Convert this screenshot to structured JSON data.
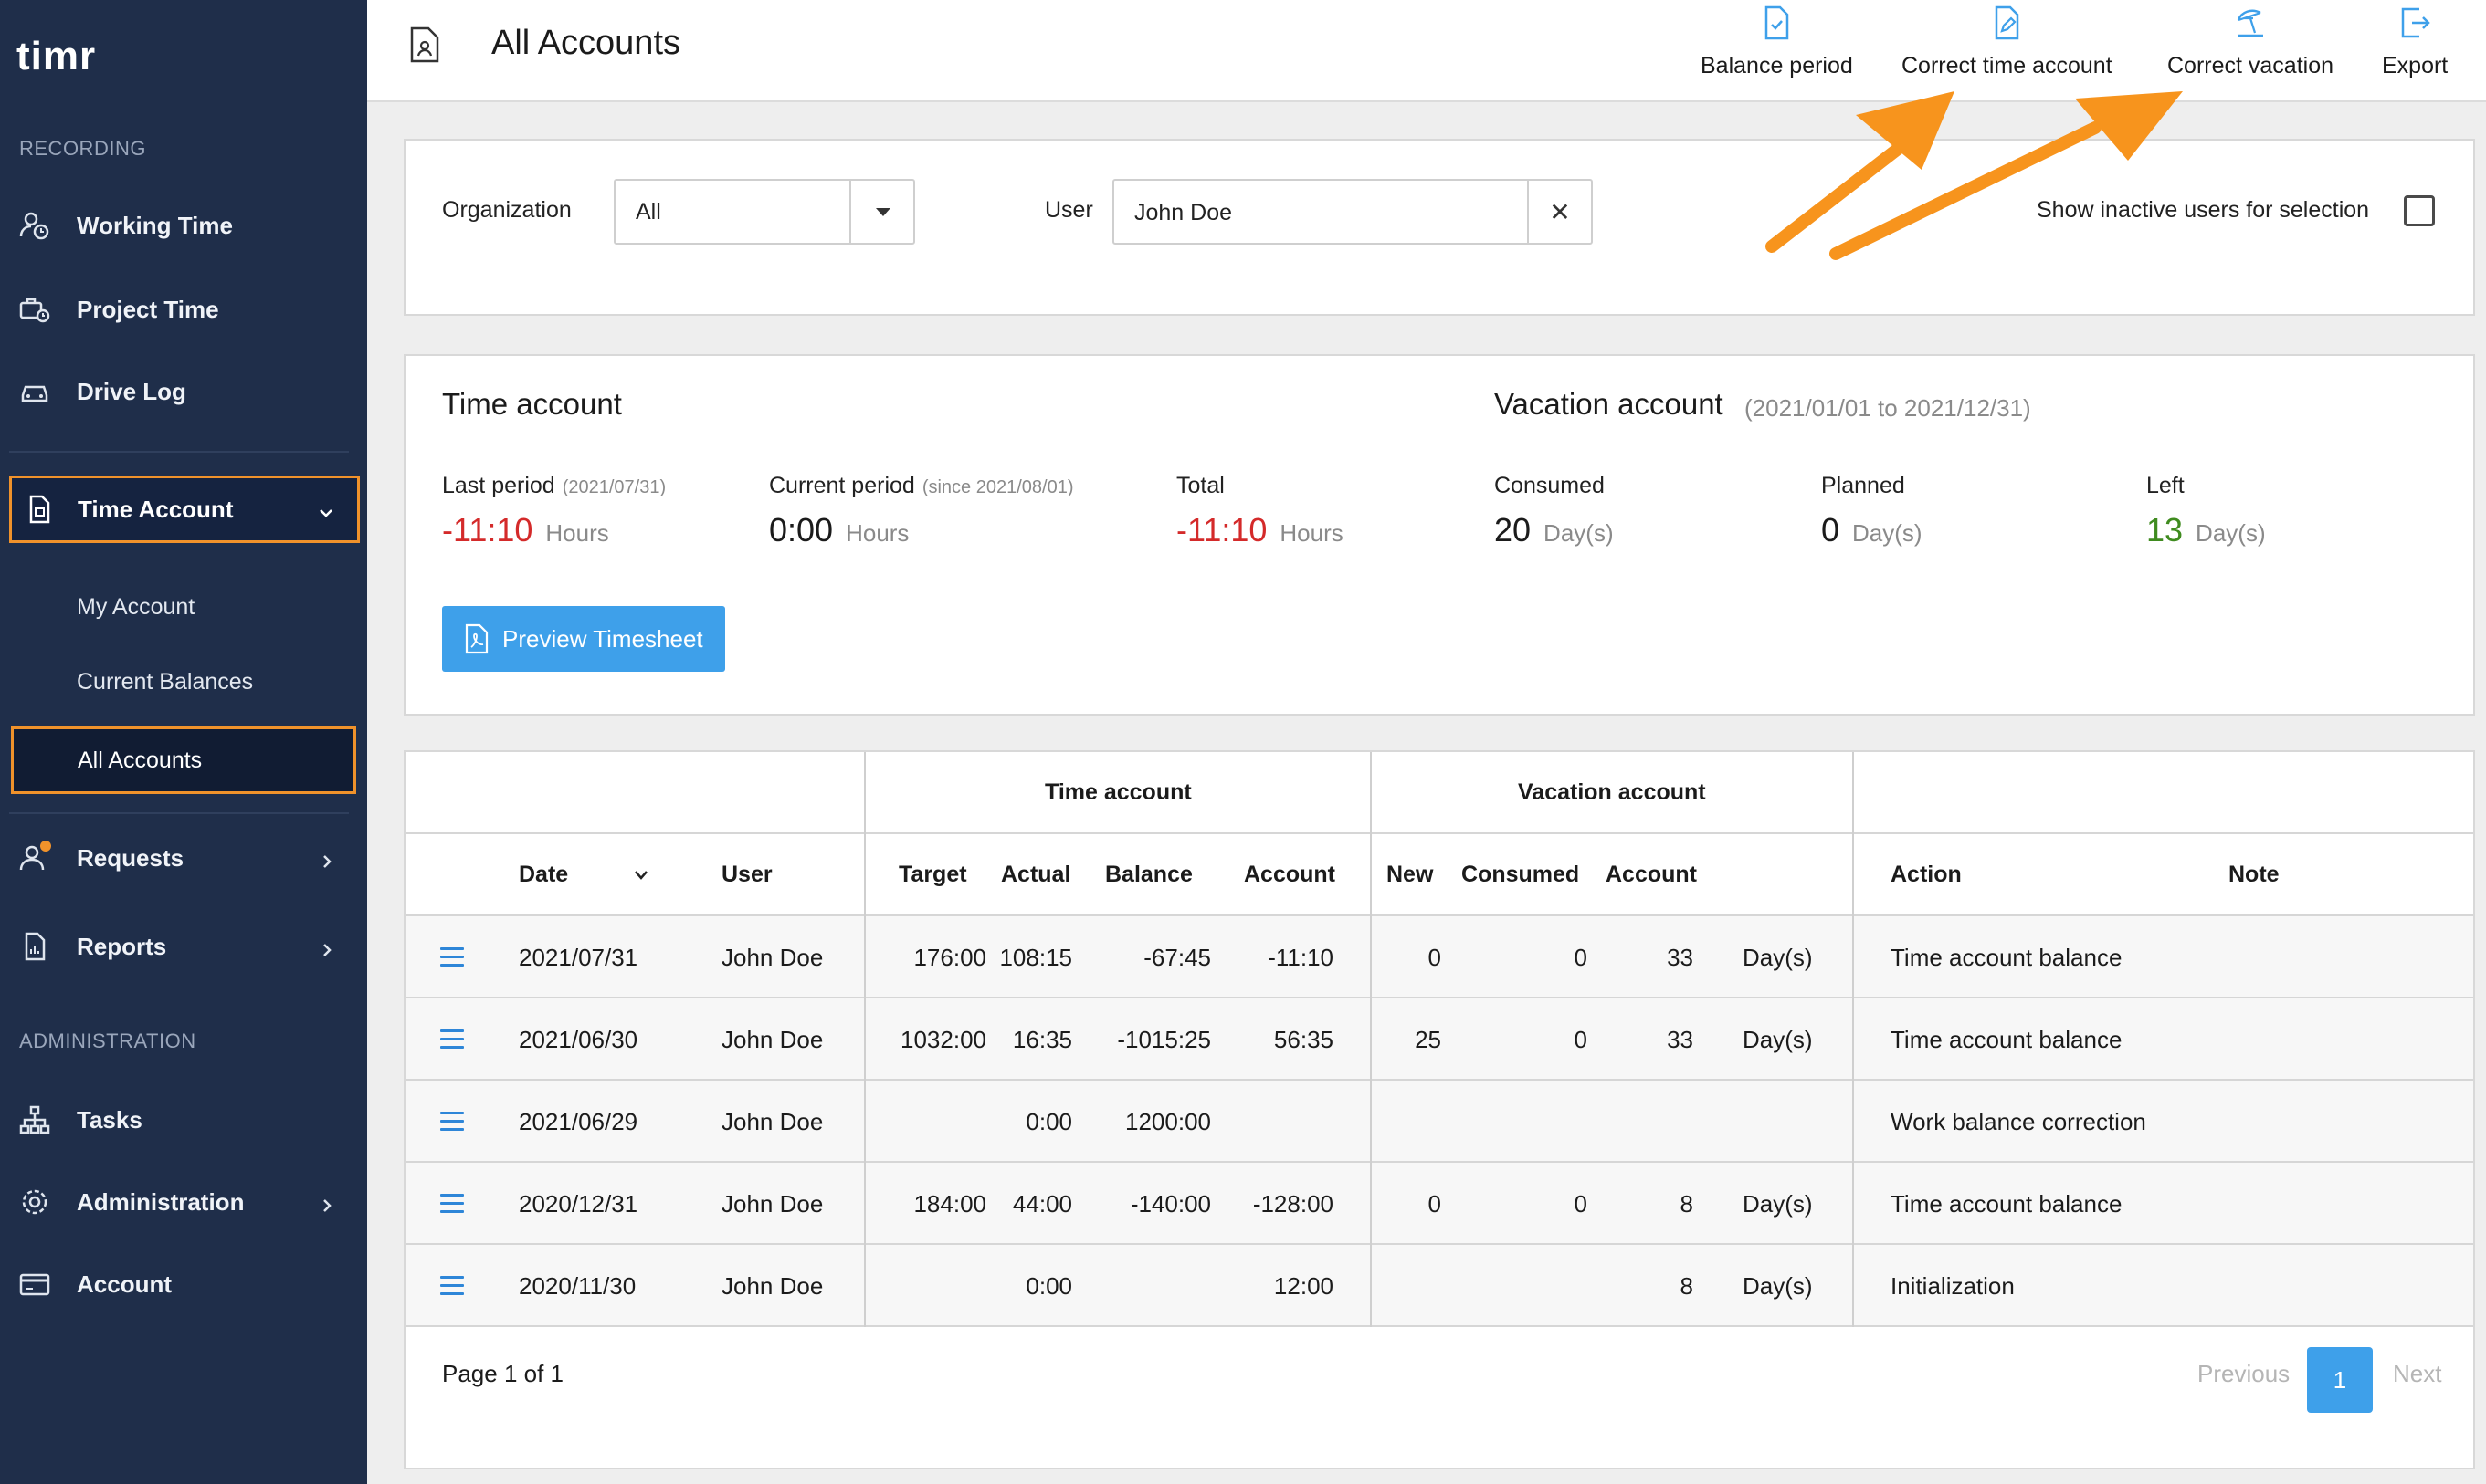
{
  "sidebar": {
    "logo_text": "timr",
    "sections": {
      "recording": "RECORDING",
      "administration": "ADMINISTRATION"
    },
    "items": {
      "working_time": "Working Time",
      "project_time": "Project Time",
      "drive_log": "Drive Log",
      "time_account": "Time Account",
      "my_account": "My Account",
      "current_balances": "Current Balances",
      "all_accounts": "All Accounts",
      "requests": "Requests",
      "reports": "Reports",
      "tasks": "Tasks",
      "administration": "Administration",
      "account": "Account"
    },
    "colors": {
      "background": "#1f2e4a",
      "active_border": "#f0922b"
    }
  },
  "header": {
    "title": "All Accounts",
    "actions": {
      "balance_period": "Balance period",
      "correct_time_account": "Correct time account",
      "correct_vacation": "Correct vacation",
      "export": "Export"
    }
  },
  "filters": {
    "organization_label": "Organization",
    "organization_value": "All",
    "user_label": "User",
    "user_value": "John Doe",
    "clear_symbol": "✕",
    "show_inactive_label": "Show inactive users for selection",
    "show_inactive_checked": false
  },
  "summary": {
    "time_account_title": "Time account",
    "vacation_account_title": "Vacation account",
    "vacation_range": "(2021/01/01 to 2021/12/31)",
    "last_period_label": "Last period",
    "last_period_date": "(2021/07/31)",
    "last_period_value": "-11:10",
    "current_period_label": "Current period",
    "current_period_since": "(since 2021/08/01)",
    "current_period_value": "0:00",
    "total_label": "Total",
    "total_value": "-11:10",
    "hours_unit": "Hours",
    "consumed_label": "Consumed",
    "consumed_value": "20",
    "planned_label": "Planned",
    "planned_value": "0",
    "left_label": "Left",
    "left_value": "13",
    "days_unit": "Day(s)",
    "preview_button": "Preview Timesheet",
    "colors": {
      "negative": "#d42a2a",
      "positive": "#3f8b1f",
      "button": "#3ea0ea"
    }
  },
  "table": {
    "group_headers": {
      "time_account": "Time account",
      "vacation_account": "Vacation account"
    },
    "columns": {
      "date": "Date",
      "user": "User",
      "target": "Target",
      "actual": "Actual",
      "balance": "Balance",
      "account": "Account",
      "new": "New",
      "consumed": "Consumed",
      "vac_account": "Account",
      "action": "Action",
      "note": "Note"
    },
    "rows": [
      {
        "date": "2021/07/31",
        "user": "John Doe",
        "target": "176:00",
        "actual": "108:15",
        "balance": "-67:45",
        "account": "-11:10",
        "new": "0",
        "consumed": "0",
        "vac_account": "33",
        "unit": "Day(s)",
        "action": "Time account balance",
        "note": ""
      },
      {
        "date": "2021/06/30",
        "user": "John Doe",
        "target": "1032:00",
        "actual": "16:35",
        "balance": "-1015:25",
        "account": "56:35",
        "new": "25",
        "consumed": "0",
        "vac_account": "33",
        "unit": "Day(s)",
        "action": "Time account balance",
        "note": ""
      },
      {
        "date": "2021/06/29",
        "user": "John Doe",
        "target": "",
        "actual": "0:00",
        "balance": "1200:00",
        "account": "",
        "new": "",
        "consumed": "",
        "vac_account": "",
        "unit": "",
        "action": "Work balance correction",
        "note": ""
      },
      {
        "date": "2020/12/31",
        "user": "John Doe",
        "target": "184:00",
        "actual": "44:00",
        "balance": "-140:00",
        "account": "-128:00",
        "new": "0",
        "consumed": "0",
        "vac_account": "8",
        "unit": "Day(s)",
        "action": "Time account balance",
        "note": ""
      },
      {
        "date": "2020/11/30",
        "user": "John Doe",
        "target": "",
        "actual": "0:00",
        "balance": "",
        "account": "12:00",
        "new": "",
        "consumed": "",
        "vac_account": "8",
        "unit": "Day(s)",
        "action": "Initialization",
        "note": ""
      }
    ],
    "pagination": {
      "text": "Page 1 of 1",
      "previous": "Previous",
      "current": "1",
      "next": "Next"
    }
  },
  "annotation_arrow_color": "#f7941d"
}
